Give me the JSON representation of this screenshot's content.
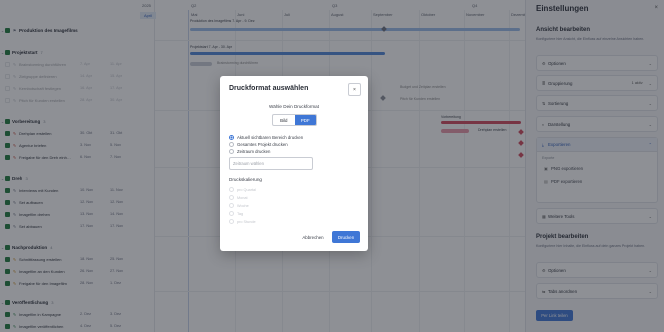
{
  "timeline": {
    "year": "2025",
    "months": [
      "April",
      "Mai",
      "Juni",
      "Juli",
      "August",
      "September",
      "Oktober",
      "November",
      "Dezember"
    ],
    "quarters": [
      "Q2",
      "Q3",
      "Q4"
    ]
  },
  "project": {
    "name": "Produktion des Imagefilms"
  },
  "groups": [
    {
      "name": "Projektstart",
      "count": "7",
      "tasks": [
        {
          "name": "Brainstorming durchführen",
          "d1": "7. Apr",
          "d2": "11. Apr"
        },
        {
          "name": "Zielgruppe definieren",
          "d1": "14. Apr",
          "d2": "15. Apr"
        },
        {
          "name": "Kernbotschaft festlegen",
          "d1": "16. Apr",
          "d2": "17. Apr"
        },
        {
          "name": "Budget und Zeitplan erstellen",
          "d1": "22. Apr",
          "d2": "25. Apr"
        },
        {
          "name": "Pitch für Kunden erstellen",
          "d1": "28. Apr",
          "d2": "30. Apr"
        }
      ]
    },
    {
      "name": "Vorbereitung",
      "count": "3",
      "tasks": [
        {
          "name": "Drehplan erstellen",
          "d1": "30. Okt",
          "d2": "31. Okt"
        },
        {
          "name": "Agentur briefen",
          "d1": "3. Nov",
          "d2": "5. Nov"
        },
        {
          "name": "Freigabe für den Dreh einholen",
          "d1": "6. Nov",
          "d2": "7. Nov"
        }
      ]
    },
    {
      "name": "Dreh",
      "count": "3",
      "tasks": [
        {
          "name": "Interviews mit Kunden",
          "d1": "10. Nov",
          "d2": "11. Nov"
        },
        {
          "name": "Set aufbauen",
          "d1": "12. Nov",
          "d2": "12. Nov"
        },
        {
          "name": "Imagefilm drehen",
          "d1": "13. Nov",
          "d2": "14. Nov"
        },
        {
          "name": "Set abbauen",
          "d1": "17. Nov",
          "d2": "17. Nov"
        }
      ]
    },
    {
      "name": "Nachproduktion",
      "count": "4",
      "tasks": [
        {
          "name": "Schnittfassung erstellen",
          "d1": "18. Nov",
          "d2": "25. Nov"
        },
        {
          "name": "Imagefilm an den Kunden",
          "d1": "26. Nov",
          "d2": "27. Nov"
        },
        {
          "name": "Freigabe für den Imagefilm",
          "d1": "28. Nov",
          "d2": "1. Dez"
        }
      ]
    },
    {
      "name": "Veröffentlichung",
      "count": "3",
      "tasks": [
        {
          "name": "Imagefilm in Kampagne",
          "d1": "2. Dez",
          "d2": "3. Dez"
        },
        {
          "name": "Imagefilm veröffentlichen",
          "d1": "4. Dez",
          "d2": "5. Dez"
        }
      ]
    }
  ],
  "gantt_labels": {
    "project_bar": "Produktion des Imagefilms 7. Apr - 9. Dez",
    "start_bar": "Projektstart 7. Apr - 30. Apr",
    "brainstorm": "Brainstorming durchführen",
    "budget": "Budget und Zeitplan erstellen",
    "pitch": "Pitch für Kunden erstellen",
    "vorbereitung": "Vorbereitung",
    "drehplan": "Drehplan erstellen"
  },
  "settings": {
    "title": "Einstellungen",
    "view_heading": "Ansicht bearbeiten",
    "view_sub": "Konfiguriere hier Ansicht, die Einfluss auf einzelne Ansichten haben.",
    "items": [
      {
        "label": "Optionen",
        "icon": "gear-icon"
      },
      {
        "label": "Gruppierung",
        "icon": "layers-icon",
        "badge": "1 aktiv"
      },
      {
        "label": "Sortierung",
        "icon": "sort-icon"
      },
      {
        "label": "Darstellung",
        "icon": "palette-icon"
      }
    ],
    "export_label": "Exportieren",
    "export_section": "Exporte",
    "export_png": "PNG exportieren",
    "export_pdf": "PDF exportieren",
    "tools_label": "Weitere Tools",
    "project_heading": "Projekt bearbeiten",
    "project_sub": "Konfiguriere hier Inhalte, die Einfluss auf dein ganzes Projekt haben.",
    "project_options": "Optionen",
    "tabs_label": "Tabs anordnen",
    "link_button": "Per Link teilen"
  },
  "modal": {
    "title": "Druckformat auswählen",
    "close": "×",
    "format_prompt": "Wähle Dein Druckformat",
    "format_image": "Bild",
    "format_pdf": "PDF",
    "range_visible": "Aktuell sichtbaren Bereich drucken",
    "range_project": "Gesamtes Projekt drucken",
    "range_period": "Zeitraum drucken",
    "period_placeholder": "Zeitraum wählen",
    "scaling_heading": "Druckskalierung",
    "scales": [
      "pro Quartal",
      "Monat",
      "Woche",
      "Tag",
      "pro Stunde"
    ],
    "cancel": "Abbrechen",
    "print": "Drucken"
  }
}
